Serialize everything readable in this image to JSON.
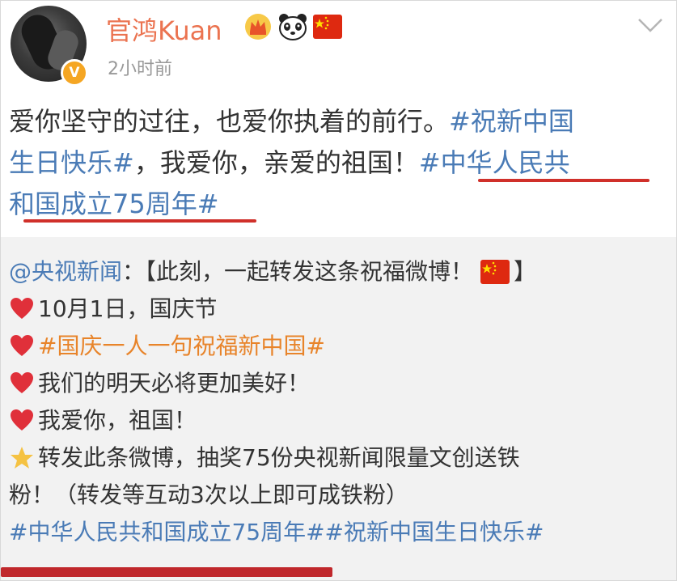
{
  "header": {
    "username": "官鸿Kuan",
    "time": "2小时前",
    "verified_badge": "V",
    "badges": [
      "crown-badge-icon",
      "panda-icon",
      "china-flag-icon"
    ]
  },
  "post": {
    "lines": [
      {
        "plain": "爱你坚守的过往，也爱你执着的前行。",
        "tag": "#祝新中国"
      },
      {
        "tag": "生日快乐#",
        "plain": "，我爱你，亲爱的祖国！",
        "tag2": "#中华人民共"
      },
      {
        "tag": "和国成立75周年#"
      }
    ]
  },
  "repost": {
    "line1_mention": "@央视新闻",
    "line1_text": "：【此刻，一起转发这条祝福微博！",
    "line1_end": "】",
    "line2": "10月1日，国庆节",
    "line3": "#国庆一人一句祝福新中国#",
    "line4": "我们的明天必将更加美好！",
    "line5": "我爱你，祖国！",
    "line6": "转发此条微博，抽奖75份央视新闻限量文创送铁",
    "line7": "粉！（转发等互动3次以上即可成铁粉）",
    "line8": "#中华人民共和国成立75周年##祝新中国生日快乐#"
  },
  "colors": {
    "username": "#eb7350",
    "hashtag": "#4a7bb6",
    "underline": "#d0302a",
    "repost_bg": "#f2f2f2",
    "time": "#999999"
  }
}
